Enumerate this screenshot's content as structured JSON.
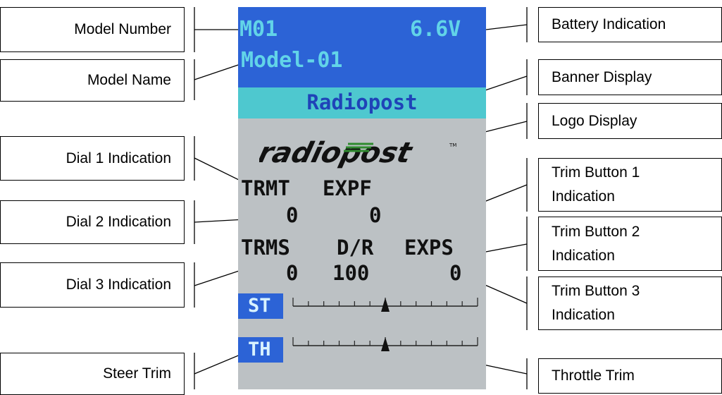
{
  "callouts": {
    "model_number": "Model Number",
    "model_name": "Model Name",
    "dial1": "Dial 1 Indication",
    "dial2": "Dial 2 Indication",
    "dial3": "Dial 3 Indication",
    "steer_trim": "Steer Trim",
    "battery": "Battery Indication",
    "banner": "Banner Display",
    "logo": "Logo Display",
    "trim1_line1": "Trim Button 1",
    "trim1_line2": "Indication",
    "trim2_line1": "Trim Button 2",
    "trim2_line2": "Indication",
    "trim3_line1": "Trim Button 3",
    "trim3_line2": "Indication",
    "throttle_trim": "Throttle Trim"
  },
  "screen": {
    "model_number": "M01",
    "battery": "6.6V",
    "model_name": "Model-01",
    "banner": "Radiopost",
    "logo_text": "radiopost",
    "logo_tm": "TM",
    "labels_row1": {
      "a": "TRMT",
      "b": "EXPF"
    },
    "values_row1": {
      "a": "0",
      "b": "0"
    },
    "labels_row2": {
      "a": "TRMS",
      "b": "D/R",
      "c": "EXPS"
    },
    "values_row2": {
      "a": "0",
      "b": "100",
      "c": "0"
    },
    "steer_label": "ST",
    "throttle_label": "TH",
    "steer_trim_position": 0.5,
    "throttle_trim_position": 0.5,
    "colors": {
      "header_bg": "#2c63d6",
      "header_text": "#62d4e8",
      "banner_bg": "#4ec8cf",
      "banner_text": "#1f43b8",
      "body_bg": "#bcc1c4",
      "body_text": "#111111",
      "trim_label_bg": "#2c63d6",
      "trim_label_text": "#d8f2ff"
    }
  }
}
